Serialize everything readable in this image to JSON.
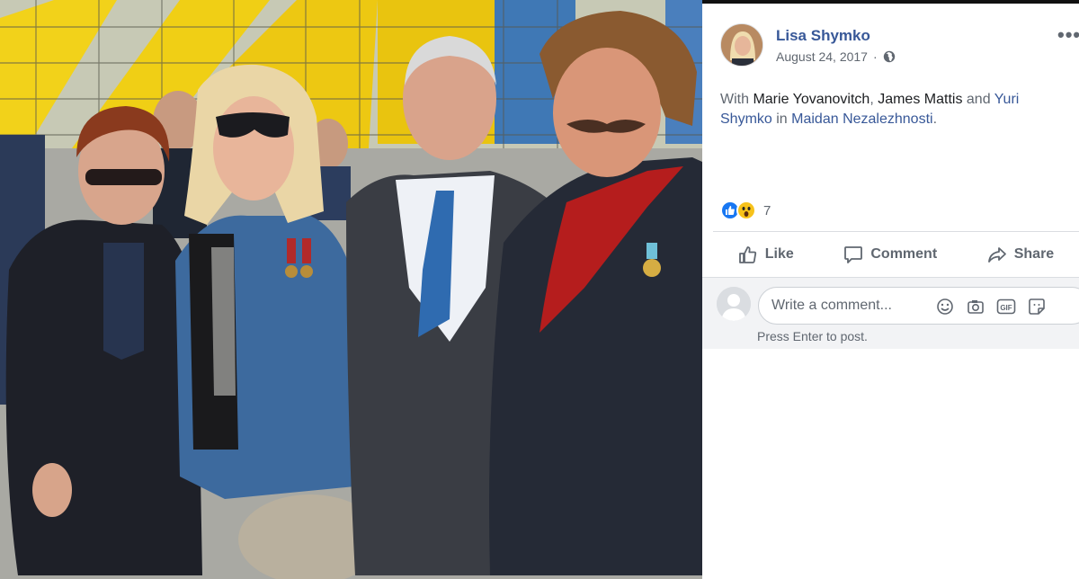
{
  "post": {
    "author": "Lisa Shymko",
    "date": "August 24, 2017",
    "date_separator": "·",
    "more": "•••",
    "text": {
      "with": "With ",
      "person1": "Marie Yovanovitch",
      "sep1": ", ",
      "person2": "James Mattis",
      "and": " and ",
      "person3": "Yuri Shymko",
      "in": " in ",
      "place": "Maidan Nezalezhnosti",
      "end": "."
    },
    "reactions": {
      "count": "7",
      "types": [
        "like-icon",
        "wow-icon"
      ]
    }
  },
  "actions": {
    "like": "Like",
    "comment": "Comment",
    "share": "Share"
  },
  "comment_box": {
    "placeholder": "Write a comment...",
    "hint": "Press Enter to post.",
    "tools": [
      "emoji-icon",
      "camera-icon",
      "gif-icon",
      "sticker-icon"
    ]
  },
  "colors": {
    "link": "#385898",
    "secondary_text": "#606770",
    "like_blue": "#1877f2",
    "wow_yellow": "#f7c21b"
  }
}
